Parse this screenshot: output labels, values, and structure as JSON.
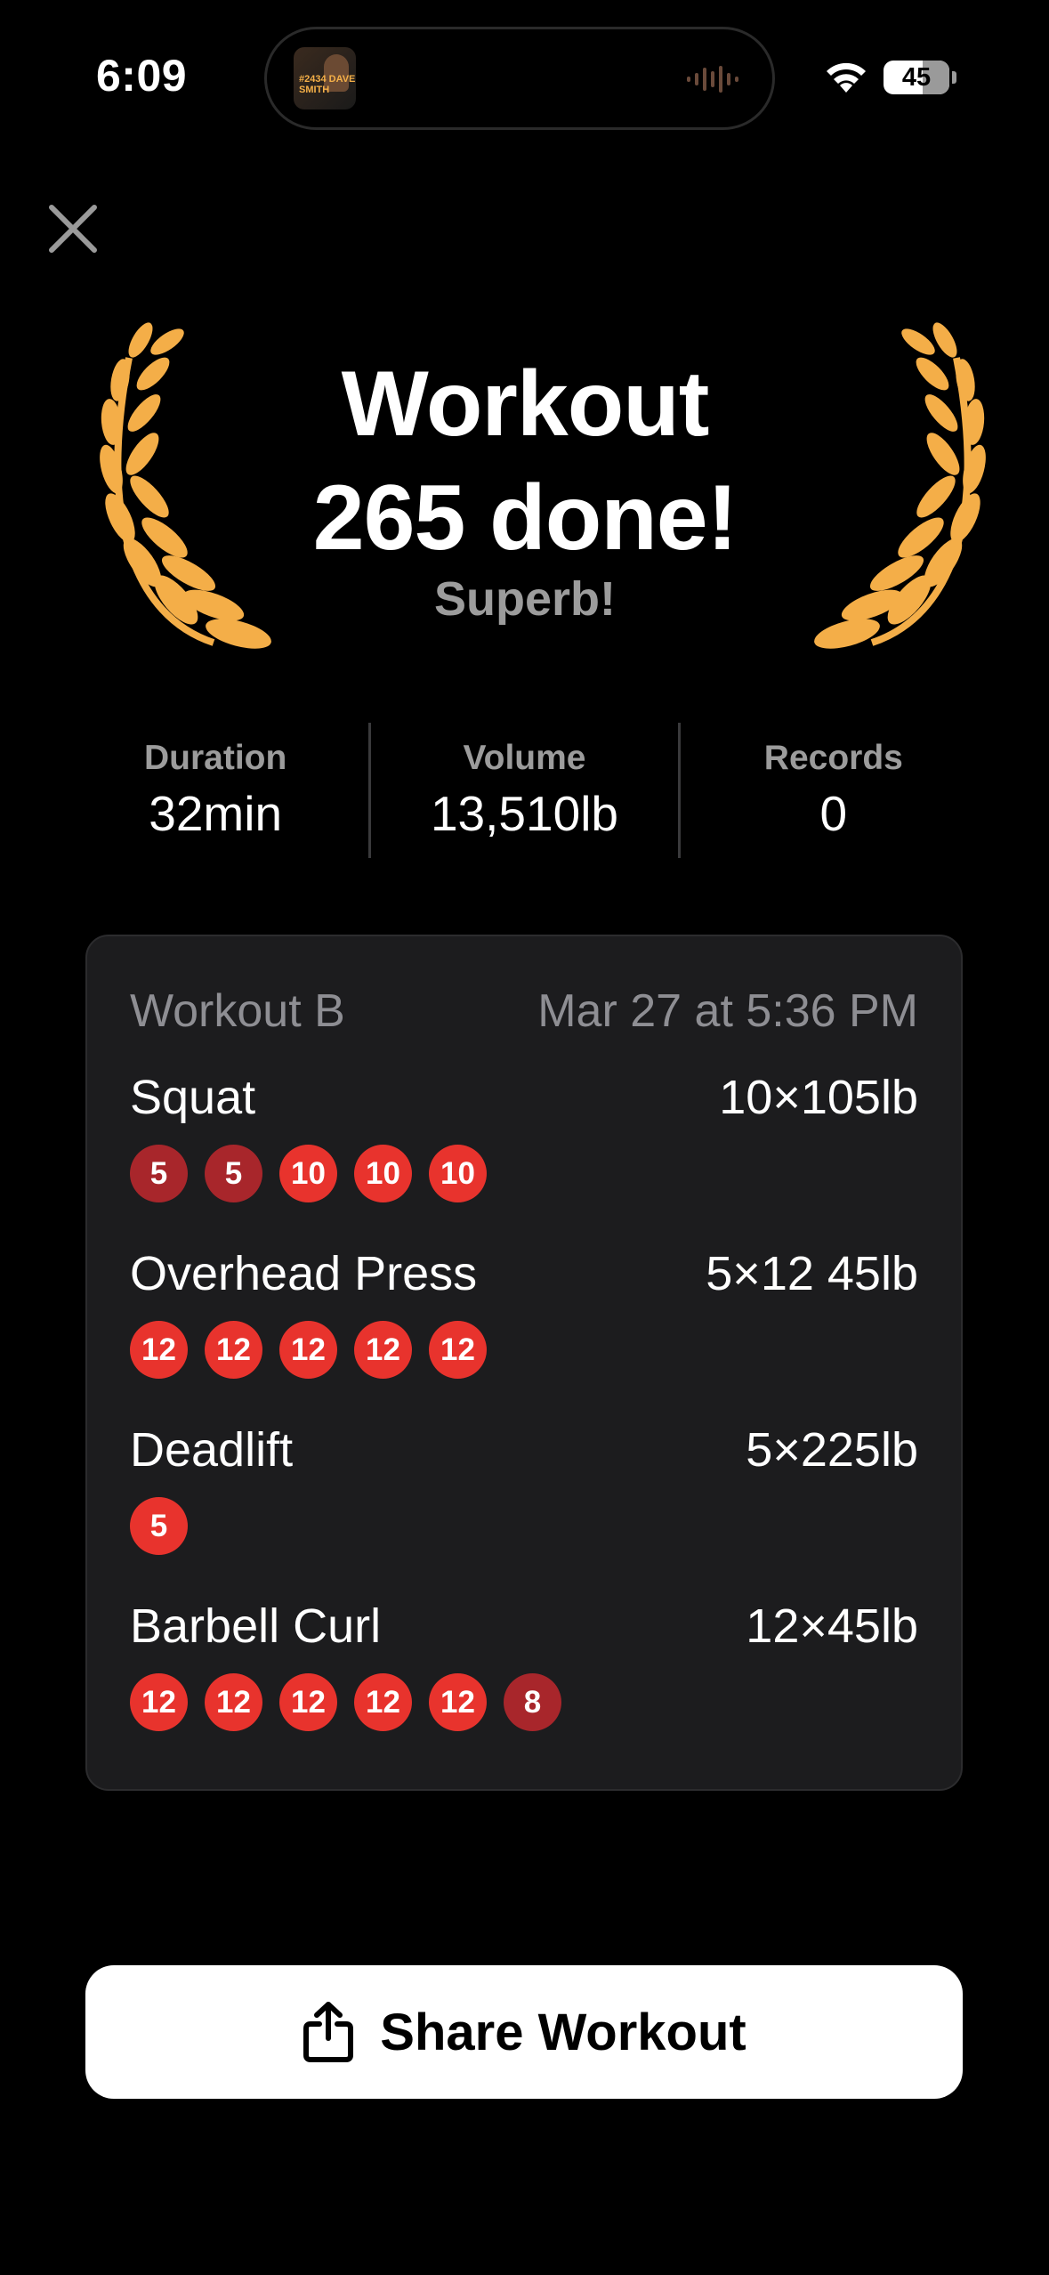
{
  "status_bar": {
    "time": "6:09",
    "battery": "45",
    "now_playing_art_text": "#2434 DAVE SMITH"
  },
  "header": {
    "close_icon": "close-icon"
  },
  "hero": {
    "title_line1": "Workout",
    "title_line2": "265 done!",
    "subtitle": "Superb!",
    "laurel_color": "#F4AE48"
  },
  "stats": [
    {
      "label": "Duration",
      "value": "32min"
    },
    {
      "label": "Volume",
      "value": "13,510lb"
    },
    {
      "label": "Records",
      "value": "0"
    }
  ],
  "summary": {
    "workout_name": "Workout B",
    "date": "Mar 27 at 5:36 PM",
    "exercises": [
      {
        "name": "Squat",
        "detail": "10×105lb",
        "sets": [
          "5",
          "5",
          "10",
          "10",
          "10"
        ],
        "dim": [
          true,
          true,
          false,
          false,
          false
        ]
      },
      {
        "name": "Overhead Press",
        "detail": "5×12 45lb",
        "sets": [
          "12",
          "12",
          "12",
          "12",
          "12"
        ],
        "dim": [
          false,
          false,
          false,
          false,
          false
        ]
      },
      {
        "name": "Deadlift",
        "detail": "5×225lb",
        "sets": [
          "5"
        ],
        "dim": [
          false
        ]
      },
      {
        "name": "Barbell Curl",
        "detail": "12×45lb",
        "sets": [
          "12",
          "12",
          "12",
          "12",
          "12",
          "8"
        ],
        "dim": [
          false,
          false,
          false,
          false,
          false,
          true
        ]
      }
    ]
  },
  "share_button": {
    "label": "Share Workout",
    "icon": "share-icon"
  },
  "colors": {
    "background": "#000000",
    "card": "#1C1C1E",
    "set_complete": "#E8332D",
    "set_partial": "#A8262B",
    "muted_text": "#9C9C9C"
  }
}
